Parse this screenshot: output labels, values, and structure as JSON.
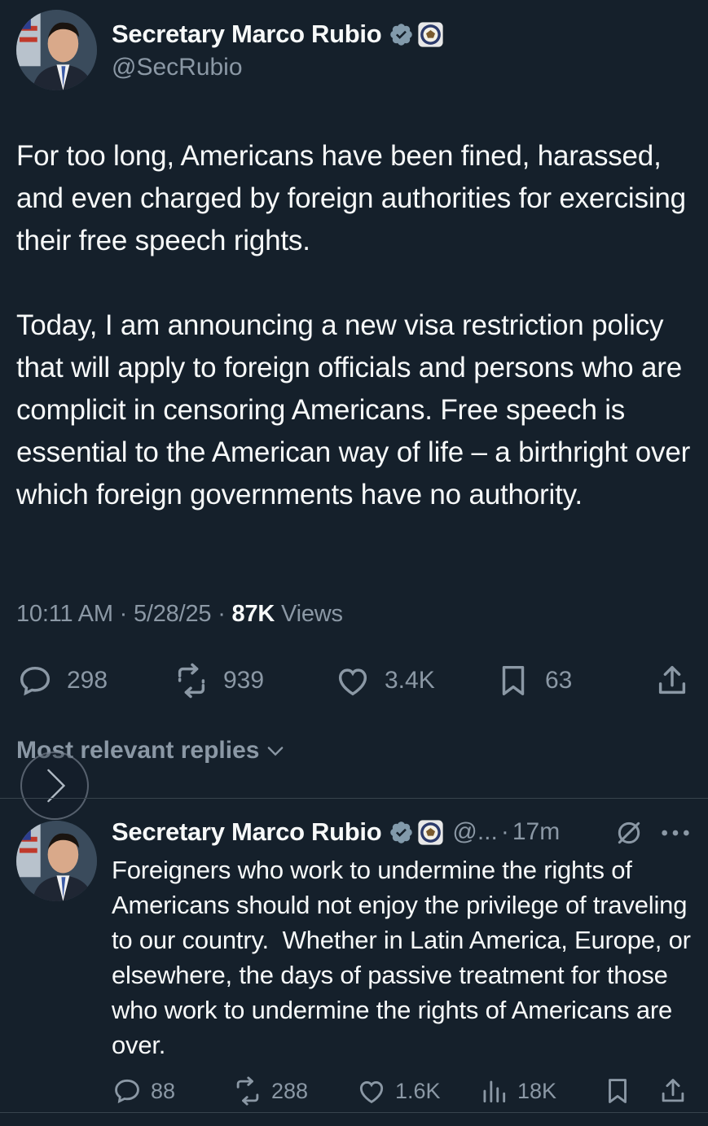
{
  "post": {
    "author_name": "Secretary Marco Rubio",
    "handle": "@SecRubio",
    "text": "For too long, Americans have been fined, harassed, and even charged by foreign authorities for exercising their free speech rights.\n\nToday, I am announcing a new visa restriction policy that will apply to foreign officials and persons who are complicit in censoring Americans. Free speech is essential to the American way of life – a birthright over which foreign governments have no authority.",
    "time": "10:11 AM",
    "date": "5/28/25",
    "separator": "·",
    "views_count": "87K",
    "views_label": "Views",
    "replies": "298",
    "reposts": "939",
    "likes": "3.4K",
    "bookmarks": "63"
  },
  "replies_section": {
    "title": "Most relevant replies"
  },
  "reply": {
    "author_name": "Secretary Marco Rubio",
    "handle": "@...",
    "separator": "·",
    "age": "17m",
    "text": "Foreigners who work to undermine the rights of Americans should not enjoy the privilege of traveling to our country.  Whether in Latin America, Europe, or elsewhere, the days of passive treatment for those who work to undermine the rights of Americans are over.",
    "replies": "88",
    "reposts": "288",
    "likes": "1.6K",
    "views": "18K"
  },
  "colors": {
    "background": "#15202b",
    "text": "#f7f9f9",
    "muted": "#8b98a5",
    "verified": "#1d9bf0",
    "divider": "#38444d"
  },
  "icons": [
    "verified-badge-icon",
    "state-department-seal-icon",
    "reply-icon",
    "repost-icon",
    "like-icon",
    "bookmark-icon",
    "share-icon",
    "chevron-down-icon",
    "chevron-right-icon",
    "grok-icon",
    "more-icon",
    "views-icon"
  ]
}
